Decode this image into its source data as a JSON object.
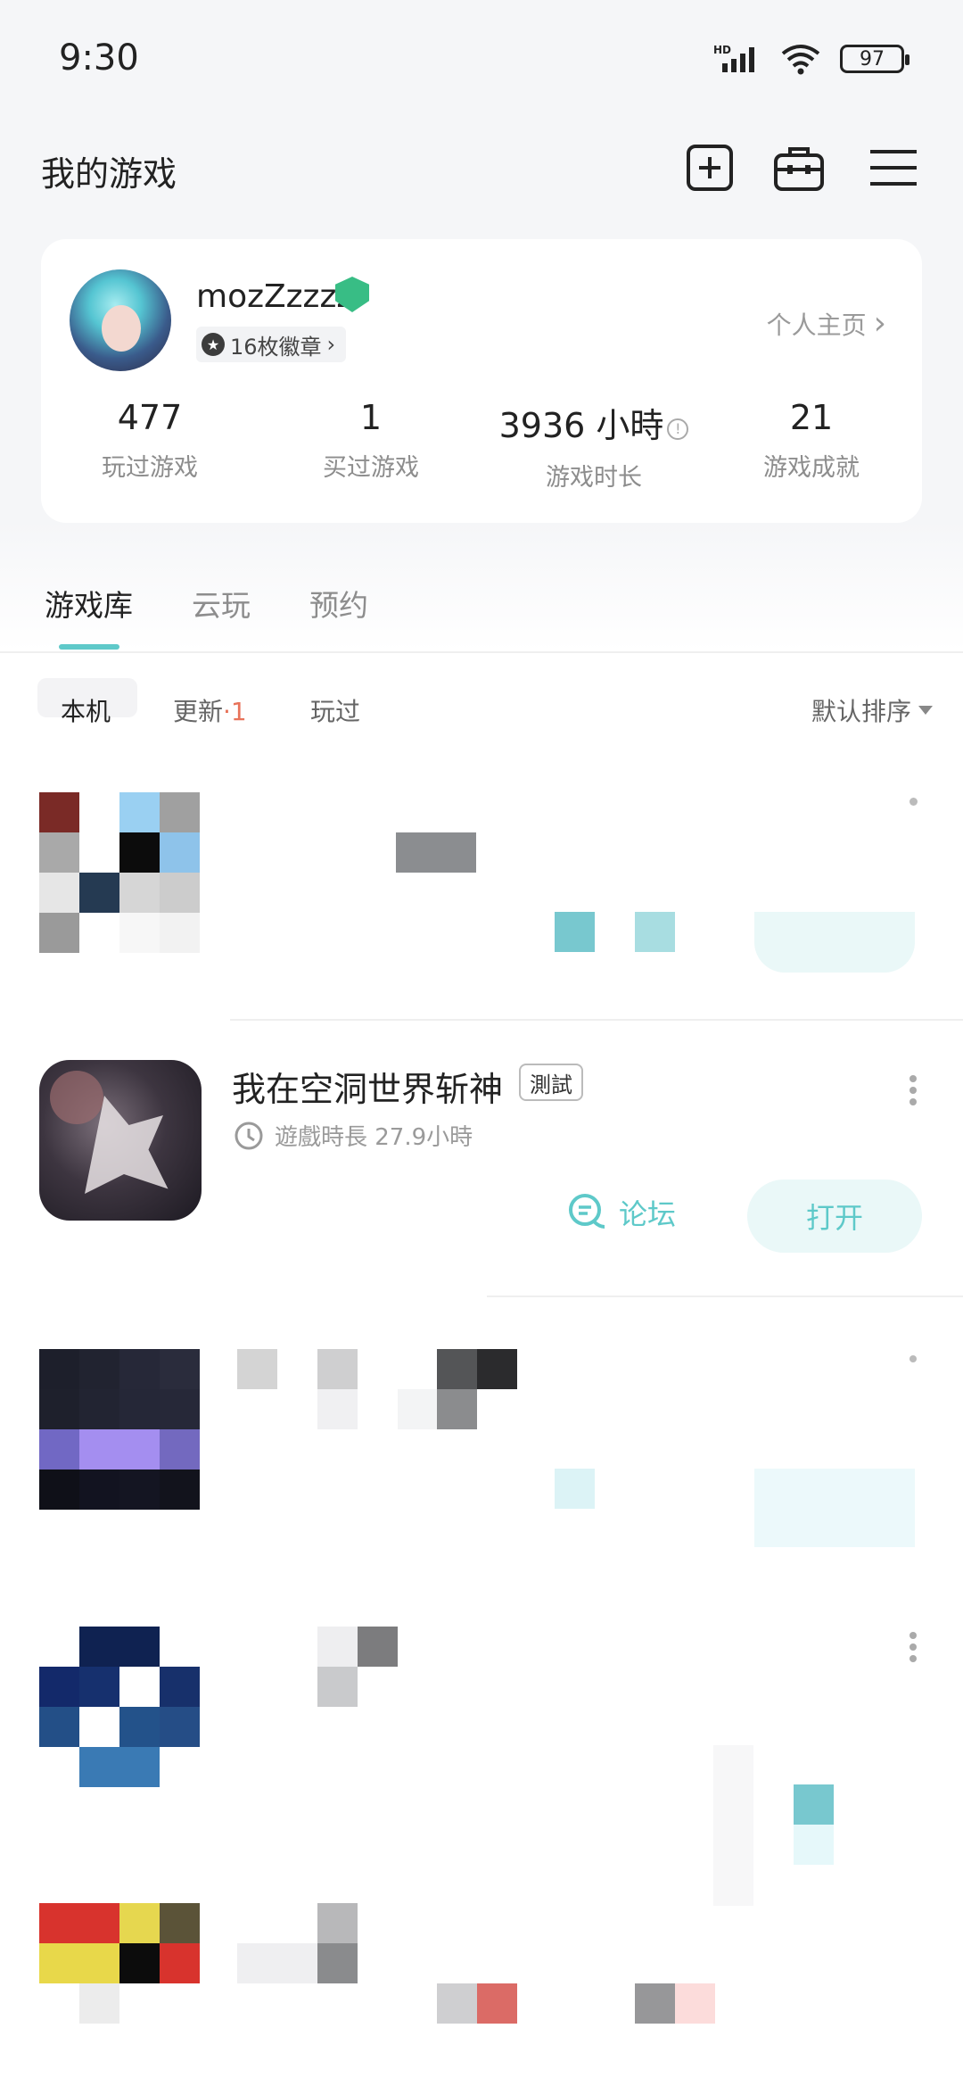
{
  "status_bar": {
    "time": "9:30",
    "battery": "97",
    "network_label": "HD"
  },
  "header": {
    "title": "我的游戏",
    "icons": [
      "add-icon",
      "toolbox-icon",
      "menu-icon"
    ]
  },
  "profile": {
    "username": "mozZzzzz",
    "medals_label": "16枚徽章",
    "homepage_link": "个人主页",
    "stats": [
      {
        "value": "477",
        "label": "玩过游戏"
      },
      {
        "value": "1",
        "label": "买过游戏"
      },
      {
        "value": "3936 小時",
        "label": "游戏时长"
      },
      {
        "value": "21",
        "label": "游戏成就"
      }
    ]
  },
  "tabs": [
    {
      "label": "游戏库",
      "active": true
    },
    {
      "label": "云玩",
      "active": false
    },
    {
      "label": "预约",
      "active": false
    }
  ],
  "filters": {
    "local": "本机",
    "update": "更新",
    "update_separator": "·",
    "update_count": "1",
    "played": "玩过",
    "sort": "默认排序"
  },
  "featured_game": {
    "title": "我在空洞世界斩神",
    "badge": "測試",
    "playtime": "遊戲時長 27.9小時",
    "forum_label": "论坛",
    "open_label": "打开"
  },
  "colors": {
    "accent": "#5ec9c9",
    "update_count": "#e8735a",
    "trophy": "#38bd85"
  }
}
